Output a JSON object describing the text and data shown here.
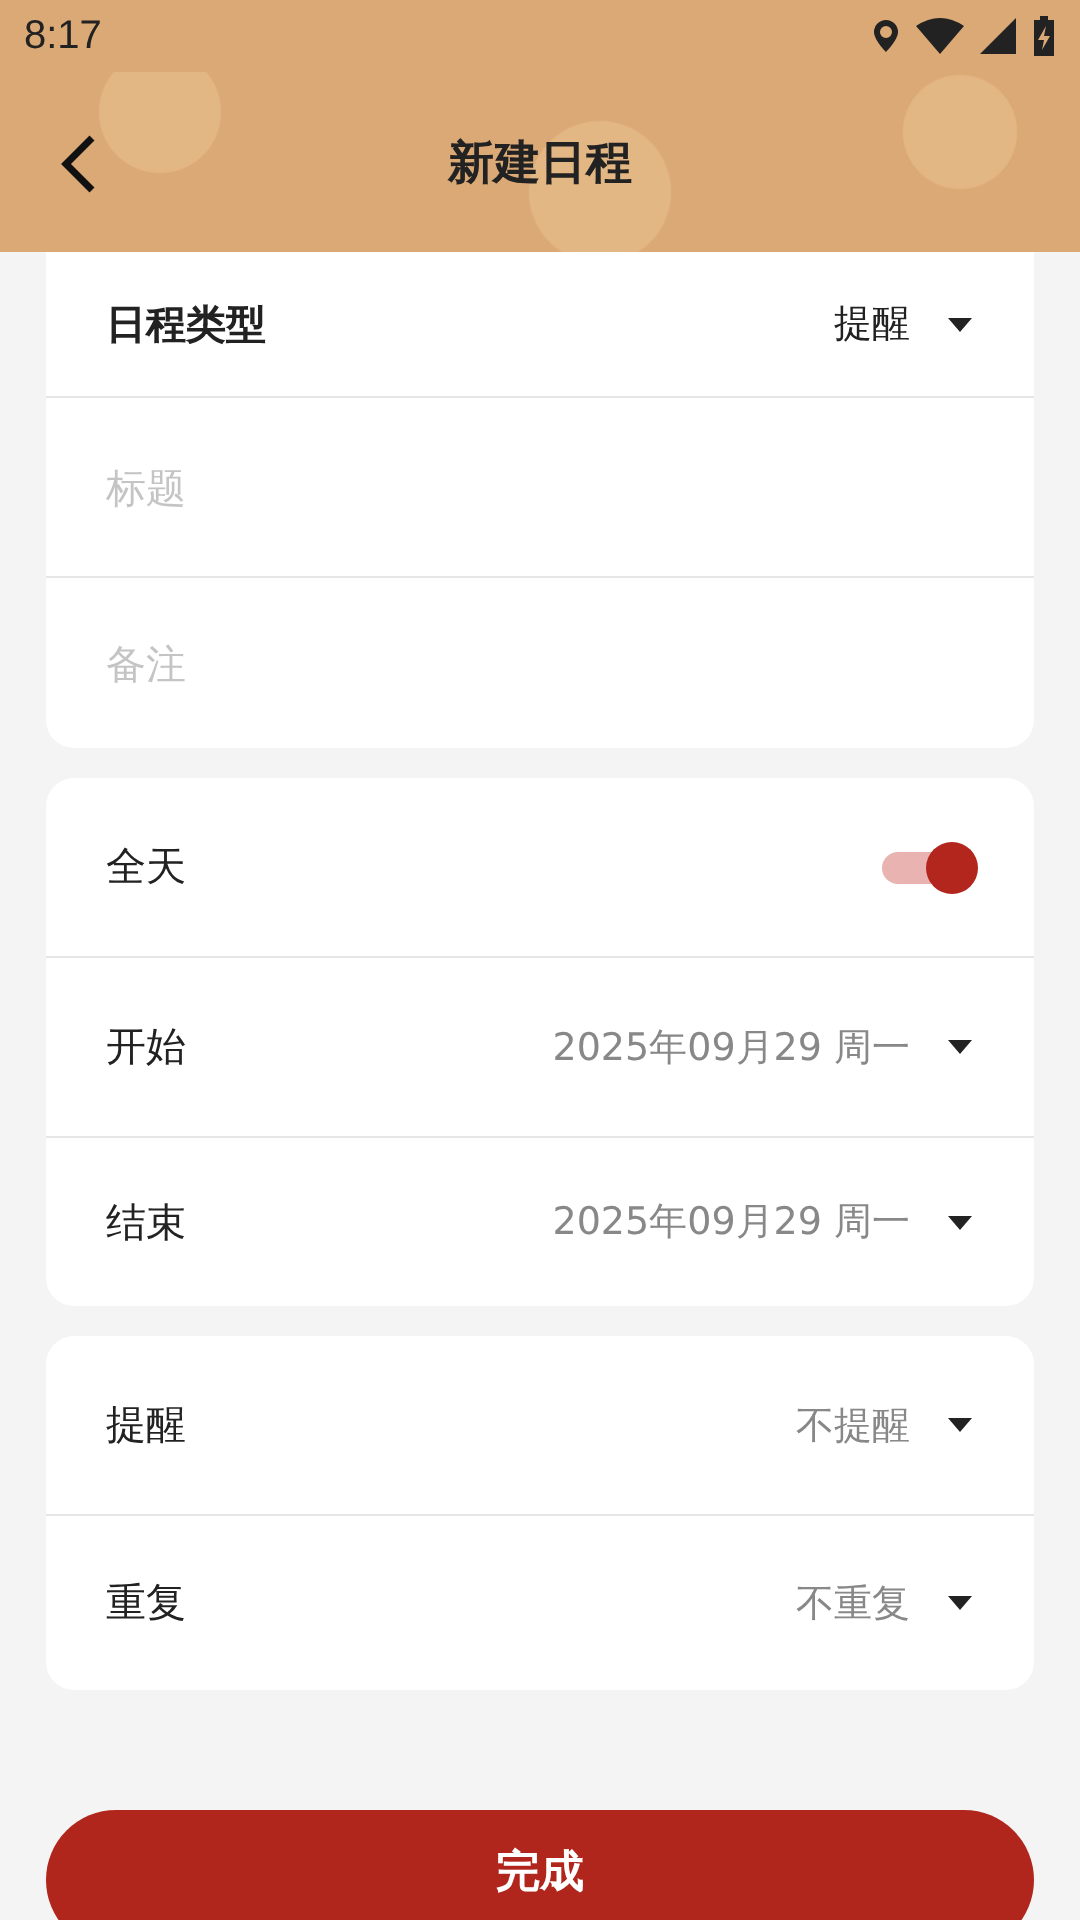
{
  "status_bar": {
    "time": "8:17"
  },
  "header": {
    "title": "新建日程"
  },
  "type_row": {
    "label": "日程类型",
    "value": "提醒"
  },
  "fields": [
    {
      "placeholder": "标题"
    },
    {
      "placeholder": "备注"
    }
  ],
  "time_card": {
    "all_day": {
      "label": "全天",
      "on": true
    },
    "rows": [
      {
        "label": "开始",
        "value": "2025年09月29 周一"
      },
      {
        "label": "结束",
        "value": "2025年09月29 周一"
      }
    ]
  },
  "reminder_card": {
    "rows": [
      {
        "label": "提醒",
        "value": "不提醒"
      },
      {
        "label": "重复",
        "value": "不重复"
      }
    ]
  },
  "done_button": "完成"
}
